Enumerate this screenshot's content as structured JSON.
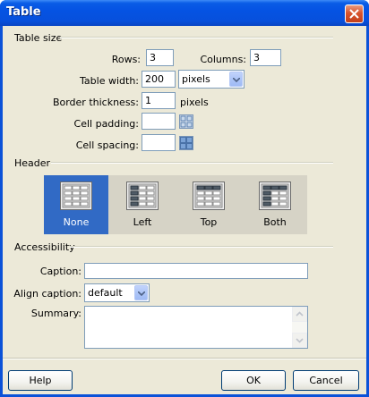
{
  "window": {
    "title": "Table"
  },
  "table_size": {
    "group_label": "Table size",
    "rows_label": "Rows:",
    "rows_value": "3",
    "columns_label": "Columns:",
    "columns_value": "3",
    "width_label": "Table width:",
    "width_value": "200",
    "width_unit": "pixels",
    "border_label": "Border thickness:",
    "border_value": "1",
    "border_unit": "pixels",
    "padding_label": "Cell padding:",
    "padding_value": "",
    "spacing_label": "Cell spacing:",
    "spacing_value": ""
  },
  "header": {
    "group_label": "Header",
    "options": [
      {
        "label": "None",
        "selected": true
      },
      {
        "label": "Left",
        "selected": false
      },
      {
        "label": "Top",
        "selected": false
      },
      {
        "label": "Both",
        "selected": false
      }
    ]
  },
  "accessibility": {
    "group_label": "Accessibility",
    "caption_label": "Caption:",
    "caption_value": "",
    "align_label": "Align caption:",
    "align_value": "default",
    "summary_label": "Summary:",
    "summary_value": ""
  },
  "buttons": {
    "help": "Help",
    "ok": "OK",
    "cancel": "Cancel"
  },
  "colors": {
    "titlebar": "#0553e3",
    "client": "#ece9d8",
    "selected": "#316ac5"
  }
}
